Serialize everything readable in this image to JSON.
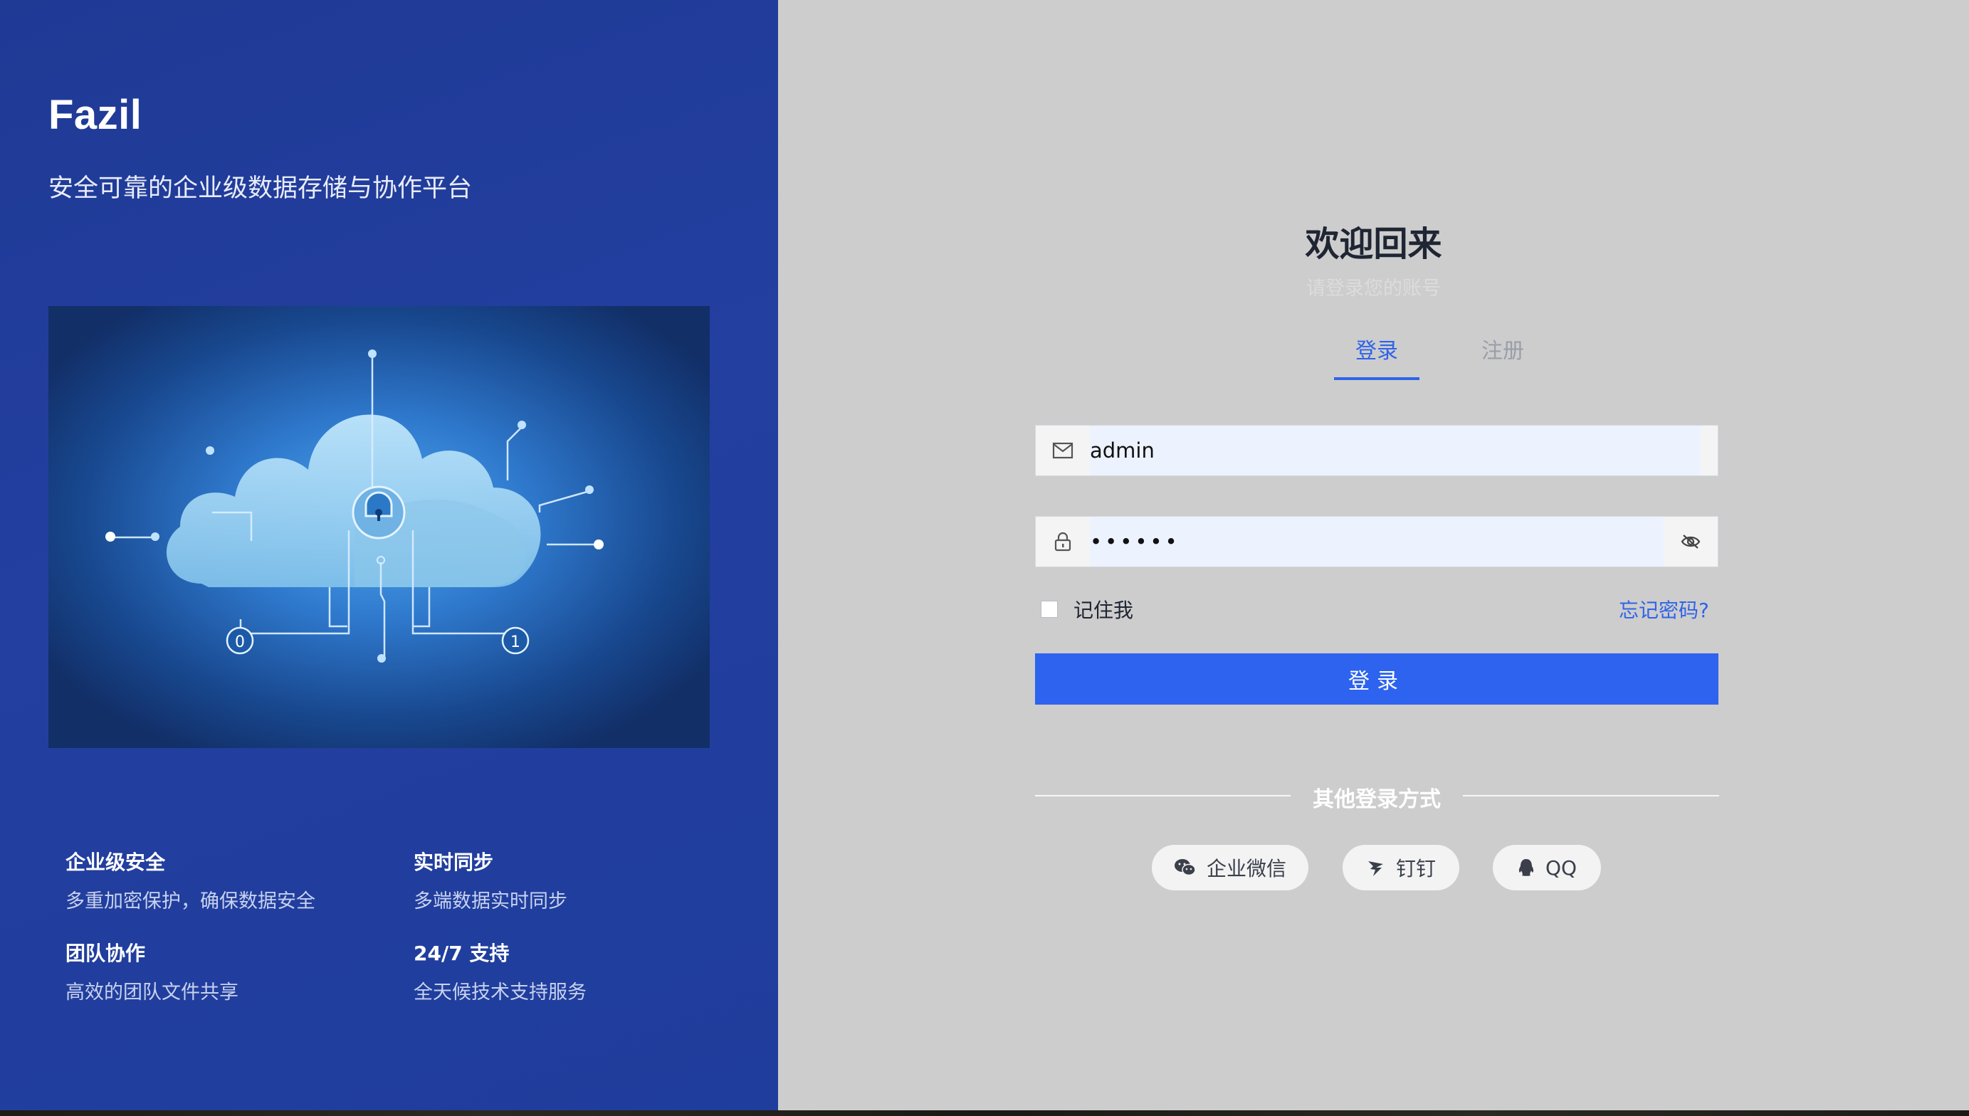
{
  "brand": {
    "name": "Fazil",
    "tagline": "安全可靠的企业级数据存储与协作平台"
  },
  "hero": {
    "icon": "cloud-lock-illustration",
    "node_labels": [
      "0",
      "1"
    ]
  },
  "features": [
    {
      "title": "企业级安全",
      "desc": "多重加密保护，确保数据安全"
    },
    {
      "title": "实时同步",
      "desc": "多端数据实时同步"
    },
    {
      "title": "团队协作",
      "desc": "高效的团队文件共享"
    },
    {
      "title": "24/7 支持",
      "desc": "全天候技术支持服务"
    }
  ],
  "login": {
    "title": "欢迎回来",
    "subtitle": "请登录您的账号",
    "tabs": [
      {
        "label": "登录",
        "active": true
      },
      {
        "label": "注册",
        "active": false
      }
    ],
    "username": {
      "value": "admin",
      "icon": "mail-icon"
    },
    "password": {
      "value": "••••••",
      "icon": "lock-icon",
      "toggle_icon": "eye-off-icon"
    },
    "remember_label": "记住我",
    "remember_checked": false,
    "forgot_label": "忘记密码?",
    "submit_label": "登录",
    "other_label": "其他登录方式",
    "social": [
      {
        "label": "企业微信",
        "icon": "wechat-work-icon"
      },
      {
        "label": "钉钉",
        "icon": "dingtalk-icon"
      },
      {
        "label": "QQ",
        "icon": "qq-icon"
      }
    ]
  },
  "colors": {
    "accent": "#2d63ef",
    "left_bg": "#233fa0",
    "right_bg": "#cdcdcd"
  }
}
